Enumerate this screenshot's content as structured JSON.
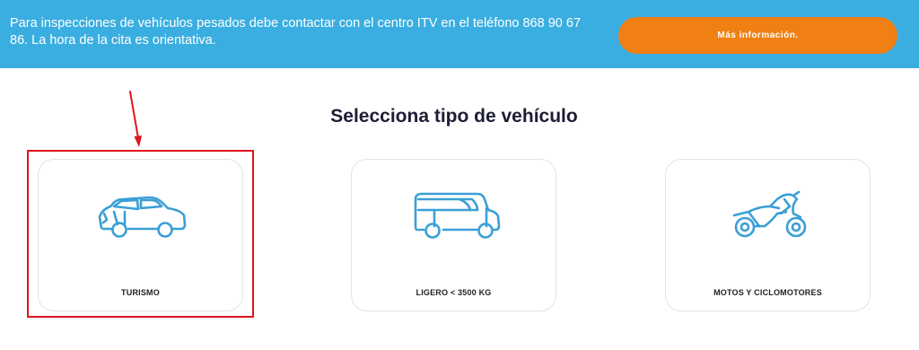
{
  "banner": {
    "text_line1": "Para inspecciones de vehículos pesados debe contactar con el centro ITV en el teléfono 868 90 67",
    "text_line2": "86. La hora de la cita es orientativa.",
    "button_label": "Más información."
  },
  "section": {
    "title": "Selecciona tipo de vehículo"
  },
  "vehicle_types": [
    {
      "label": "TURISMO",
      "icon": "car-icon"
    },
    {
      "label": "LIGERO < 3500 KG",
      "icon": "van-icon"
    },
    {
      "label": "MOTOS Y CICLOMOTORES",
      "icon": "motorcycle-icon"
    }
  ],
  "colors": {
    "banner_bg": "#3aaee0",
    "button_bg": "#f07f14",
    "icon_stroke": "#3a9fd6",
    "highlight": "#e0141c"
  }
}
